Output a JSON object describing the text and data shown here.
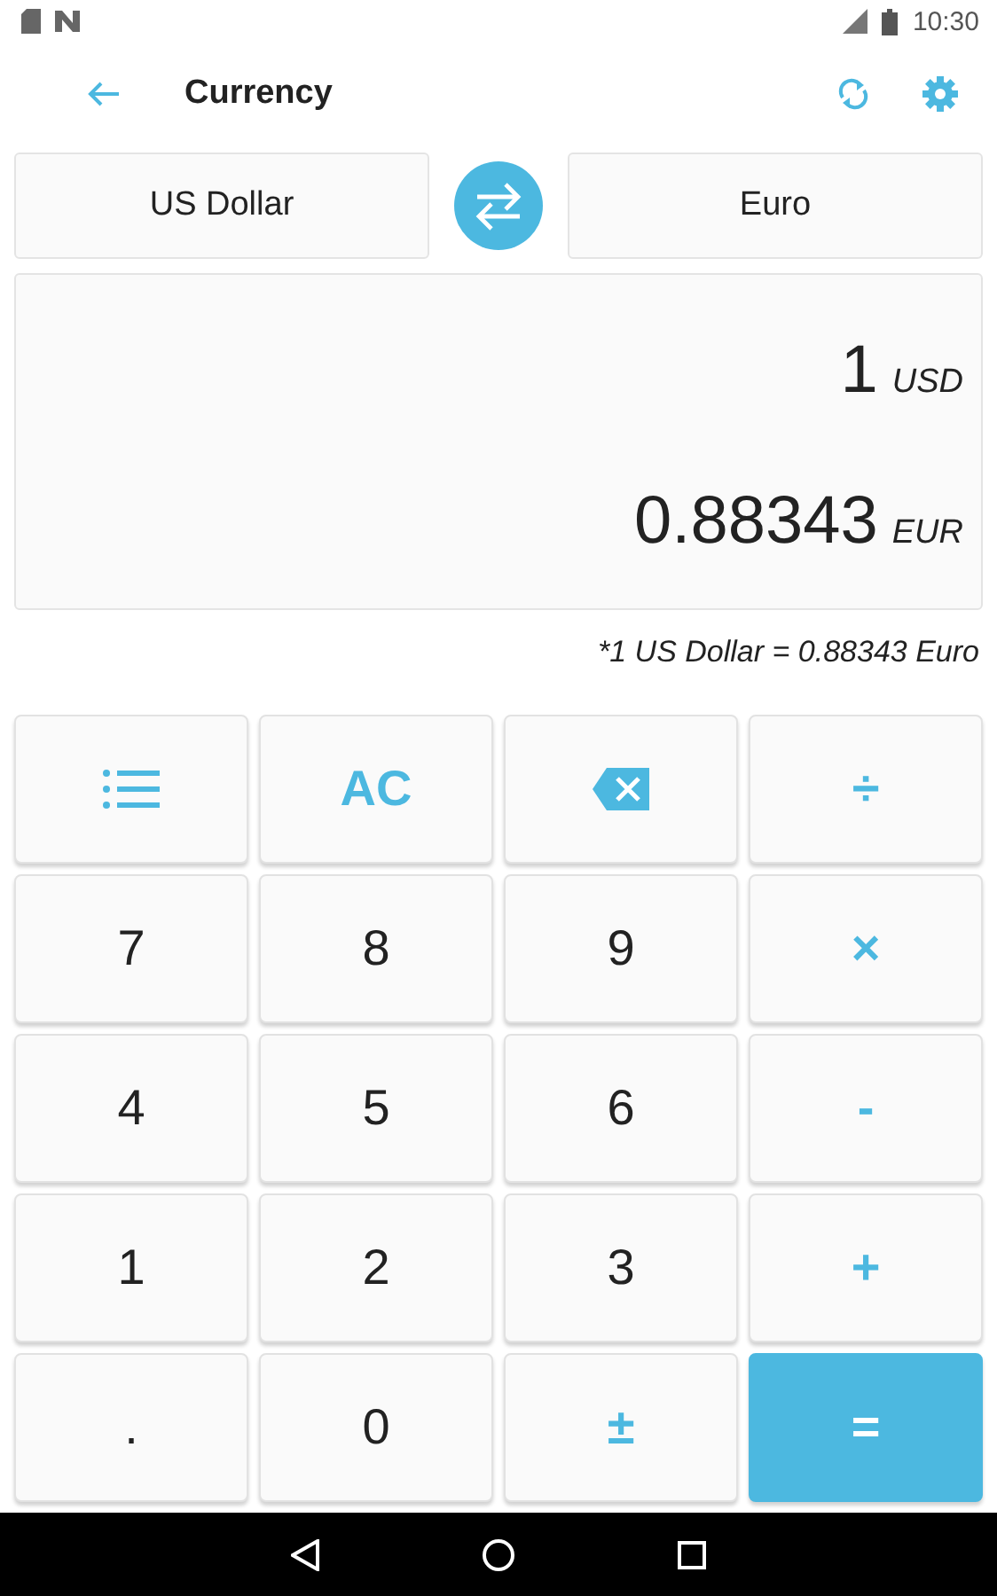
{
  "status_bar": {
    "time": "10:30"
  },
  "app_bar": {
    "title": "Currency"
  },
  "currencies": {
    "from": "US Dollar",
    "to": "Euro"
  },
  "display": {
    "input_value": "1",
    "input_code": "USD",
    "result_value": "0.88343",
    "result_code": "EUR"
  },
  "rate_note": "*1 US Dollar = 0.88343 Euro",
  "keys": [
    {
      "kind": "list"
    },
    {
      "kind": "op",
      "label": "AC"
    },
    {
      "kind": "backspace"
    },
    {
      "kind": "op",
      "label": "÷"
    },
    {
      "kind": "digit",
      "label": "7"
    },
    {
      "kind": "digit",
      "label": "8"
    },
    {
      "kind": "digit",
      "label": "9"
    },
    {
      "kind": "op",
      "label": "×"
    },
    {
      "kind": "digit",
      "label": "4"
    },
    {
      "kind": "digit",
      "label": "5"
    },
    {
      "kind": "digit",
      "label": "6"
    },
    {
      "kind": "op",
      "label": "-"
    },
    {
      "kind": "digit",
      "label": "1"
    },
    {
      "kind": "digit",
      "label": "2"
    },
    {
      "kind": "digit",
      "label": "3"
    },
    {
      "kind": "op",
      "label": "+"
    },
    {
      "kind": "digit",
      "label": "."
    },
    {
      "kind": "digit",
      "label": "0"
    },
    {
      "kind": "op",
      "label": "±"
    },
    {
      "kind": "equals",
      "label": "="
    }
  ]
}
